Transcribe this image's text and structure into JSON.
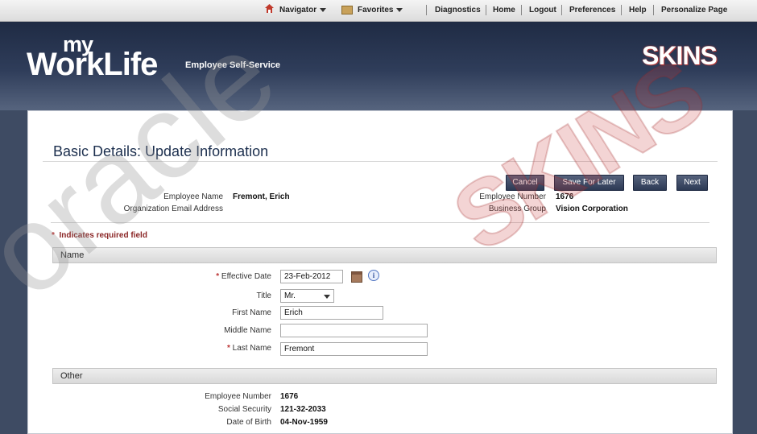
{
  "topbar": {
    "navigator": "Navigator",
    "favorites": "Favorites",
    "links": [
      "Diagnostics",
      "Home",
      "Logout",
      "Preferences",
      "Help",
      "Personalize Page"
    ]
  },
  "header": {
    "logo_my": "my",
    "logo_worklife": "WorkLife",
    "subtitle": "Employee Self-Service",
    "skins_logo": "SKINS"
  },
  "page": {
    "title": "Basic Details: Update Information",
    "buttons": {
      "cancel": "Cancel",
      "save_later": "Save For Later",
      "back": "Back",
      "next": "Next"
    },
    "summary": {
      "employee_name_label": "Employee Name",
      "employee_name": "Fremont, Erich",
      "org_email_label": "Organization Email Address",
      "org_email": "",
      "employee_number_label": "Employee Number",
      "employee_number": "1676",
      "business_group_label": "Business Group",
      "business_group": "Vision Corporation"
    },
    "required_note": "Indicates required field",
    "required_star": "*"
  },
  "name_section": {
    "title": "Name",
    "effective_date_label": "Effective Date",
    "effective_date": "23-Feb-2012",
    "title_label": "Title",
    "title_value": "Mr.",
    "first_name_label": "First Name",
    "first_name": "Erich",
    "middle_name_label": "Middle Name",
    "middle_name": "",
    "last_name_label": "Last Name",
    "last_name": "Fremont"
  },
  "other_section": {
    "title": "Other",
    "employee_number_label": "Employee Number",
    "employee_number": "1676",
    "social_security_label": "Social Security",
    "social_security": "121-32-2033",
    "dob_label": "Date of Birth",
    "dob": "04-Nov-1959"
  },
  "watermark": {
    "oracle": "oracle",
    "skins": "SKINS"
  },
  "colors": {
    "header_dark": "#1f2b44",
    "button": "#2d3a55",
    "required": "#8b2626"
  }
}
